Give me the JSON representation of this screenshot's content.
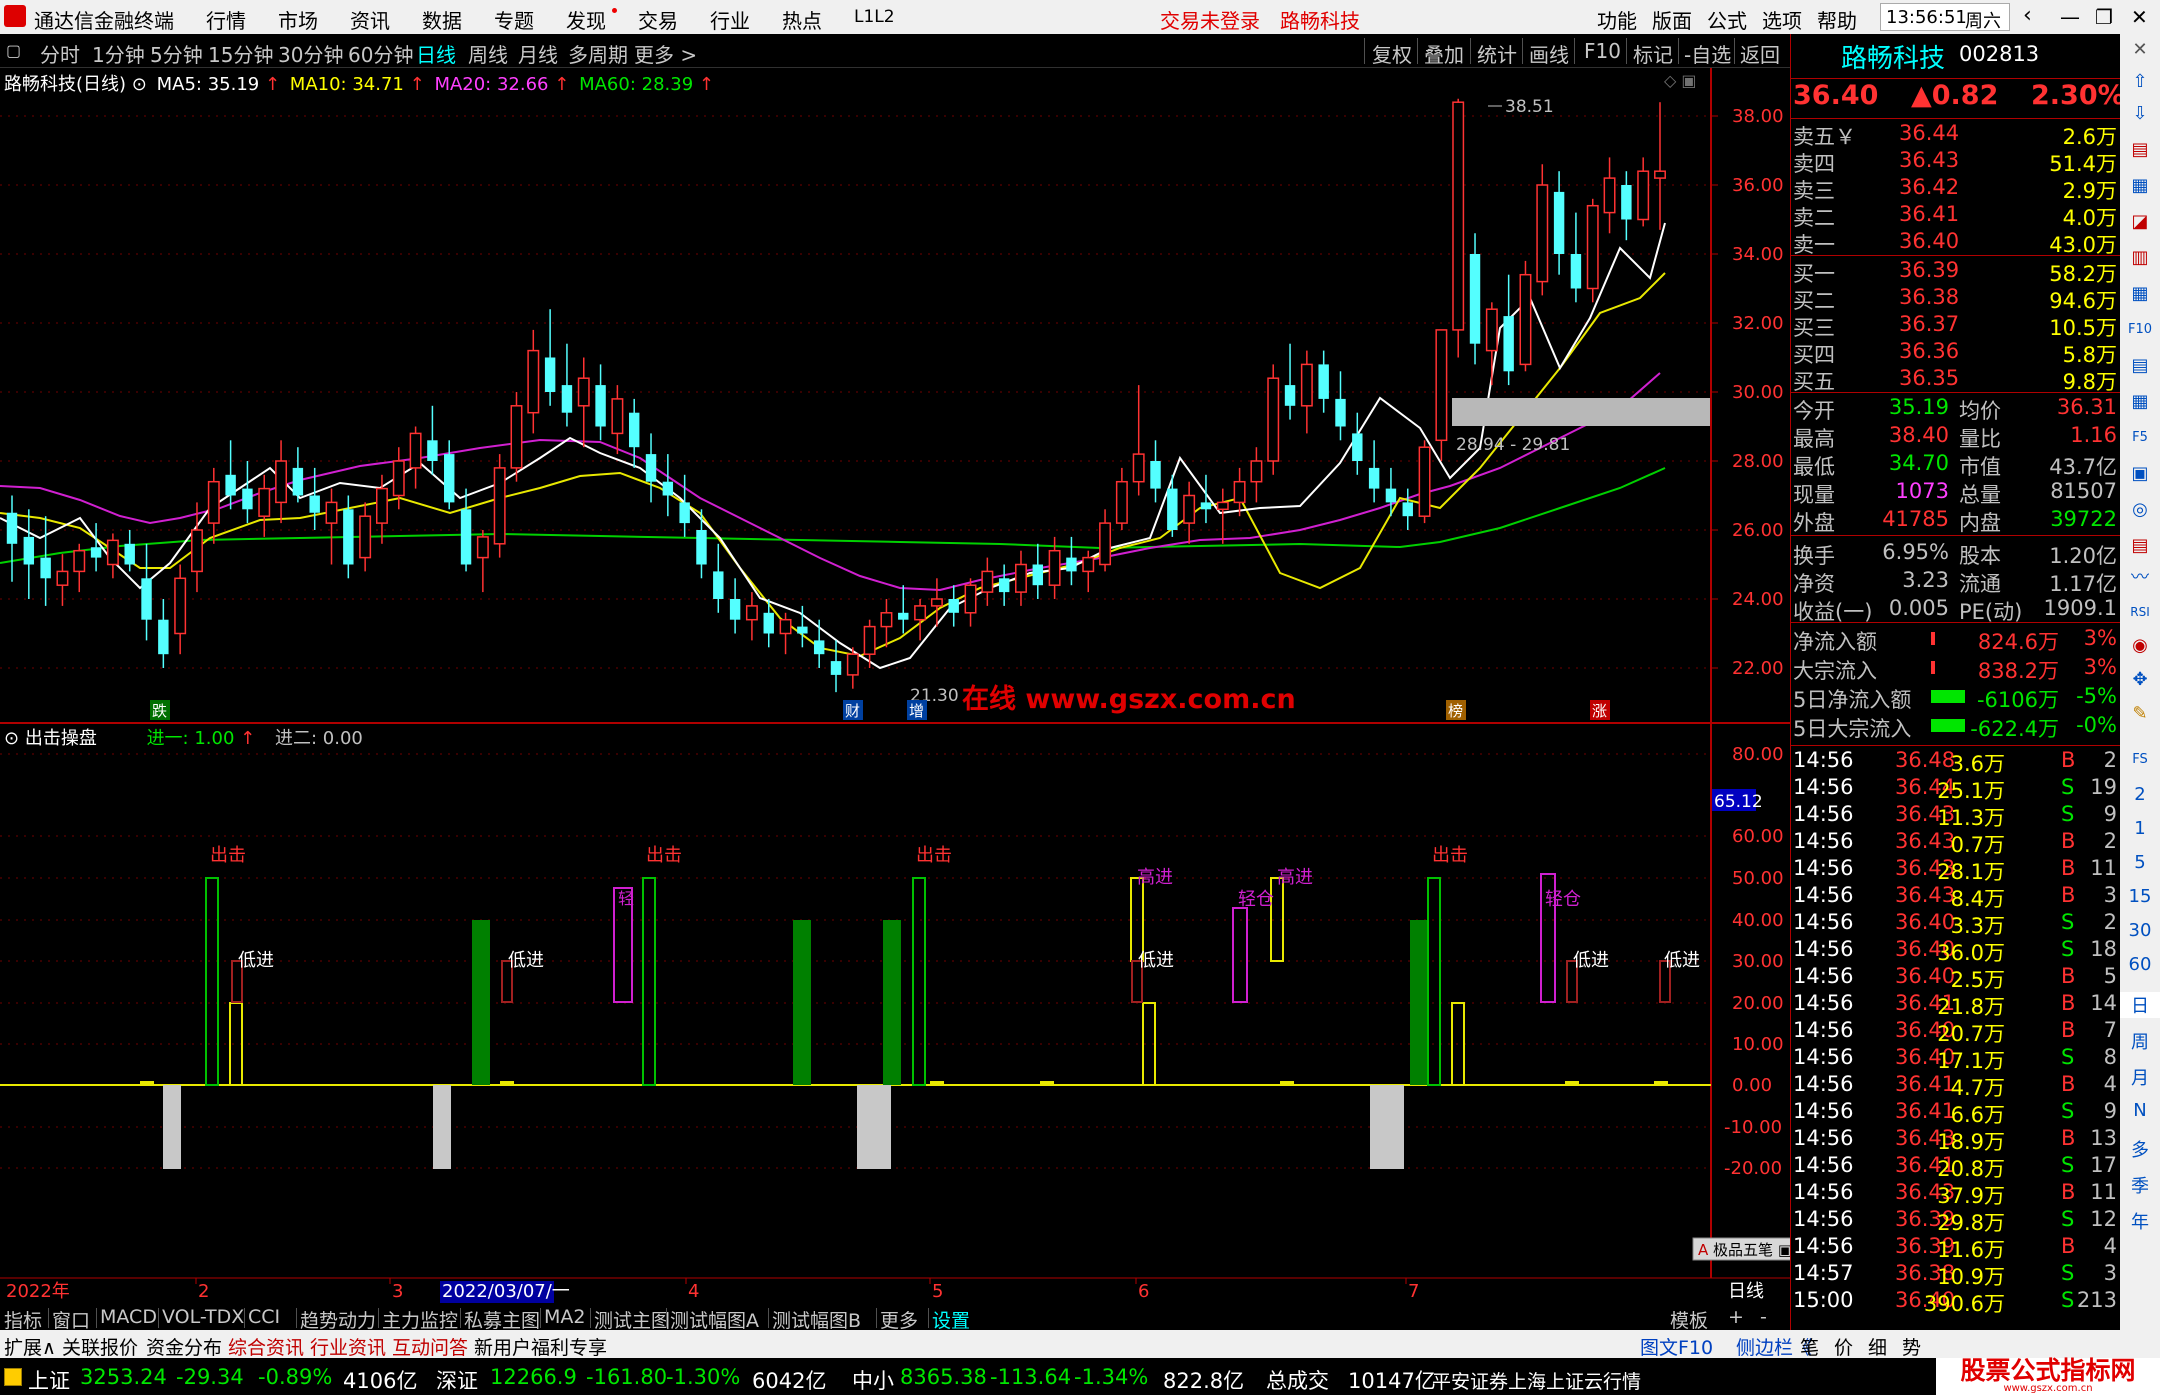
{
  "titlebar": {
    "app_name": "通达信金融终端",
    "menu": [
      "行情",
      "市场",
      "资讯",
      "数据",
      "专题",
      "发现",
      "交易",
      "行业",
      "热点",
      "L1L2"
    ],
    "status1": "交易未登录",
    "status2": "路畅科技",
    "right_menu": [
      "功能",
      "版面",
      "公式",
      "选项",
      "帮助"
    ],
    "time": "13:56:51",
    "weekday": "周六"
  },
  "periods": [
    "分时",
    "1分钟",
    "5分钟",
    "15分钟",
    "30分钟",
    "60分钟",
    "日线",
    "周线",
    "月线",
    "多周期",
    "更多 >"
  ],
  "active_period": "日线",
  "toolbar_right": [
    "复权",
    "叠加",
    "统计",
    "画线",
    "F10",
    "标记",
    "-自选",
    "返回"
  ],
  "chart_header": {
    "name": "路畅科技(日线)",
    "ma5": "MA5: 35.19",
    "ma10": "MA10: 34.71",
    "ma20": "MA20: 32.66",
    "ma60": "MA60: 28.39",
    "colors": {
      "ma5": "#ffffff",
      "ma10": "#ffff00",
      "ma20": "#ff40ff",
      "ma60": "#00e600"
    }
  },
  "price_axis": [
    "38.00",
    "36.00",
    "34.00",
    "32.00",
    "30.00",
    "28.00",
    "26.00",
    "24.00",
    "22.00"
  ],
  "annotations": {
    "high": "38.51",
    "low": "21.30",
    "range": "28.94 - 29.81",
    "watermark": "在线  www.gszx.com.cn",
    "markers": [
      "跌",
      "财",
      "增",
      "榜",
      "涨"
    ]
  },
  "indicator_header": {
    "name": "出击操盘",
    "v1": "进一: 1.00",
    "v2": "进二: 0.00"
  },
  "indicator_axis": [
    "80.00",
    "65.12",
    "60.00",
    "50.00",
    "40.00",
    "30.00",
    "20.00",
    "10.00",
    "0.00",
    "-10.00",
    "-20.00"
  ],
  "indicator_labels": {
    "chuji": "出击",
    "dijin": "低进",
    "gaojin": "高进",
    "qingcang": "轻仓"
  },
  "time_axis": [
    "2022年",
    "2",
    "3",
    "2022/03/07/一",
    "4",
    "5",
    "6",
    "7",
    "日线"
  ],
  "bottom_tabs": [
    "指标",
    "窗口",
    "MACD",
    "VOL-TDX",
    "CCI",
    "趋势动力",
    "主力监控",
    "私募主图",
    "MA2",
    "测试主图",
    "测试幅图A",
    "测试幅图B",
    "更多",
    "设置"
  ],
  "bottom_tabs_right": [
    "模板",
    "+",
    "-"
  ],
  "lower_tabs": [
    "扩展∧",
    "关联报价",
    "资金分布",
    "综合资讯",
    "行业资讯",
    "互动问答",
    "新用户福利专享"
  ],
  "lower_tabs_right": [
    "图文F10",
    "侧边栏《",
    "笔",
    "价",
    "细",
    "势"
  ],
  "widget": "极品五笔",
  "quote": {
    "name": "路畅科技",
    "code": "002813",
    "price": "36.40",
    "change": "▲0.82",
    "pct": "2.30%",
    "asks": [
      {
        "label": "卖五￥",
        "price": "36.44",
        "vol": "2.6万"
      },
      {
        "label": "卖四",
        "price": "36.43",
        "vol": "51.4万"
      },
      {
        "label": "卖三",
        "price": "36.42",
        "vol": "2.9万"
      },
      {
        "label": "卖二",
        "price": "36.41",
        "vol": "4.0万"
      },
      {
        "label": "卖一",
        "price": "36.40",
        "vol": "43.0万"
      }
    ],
    "bids": [
      {
        "label": "买一",
        "price": "36.39",
        "vol": "58.2万"
      },
      {
        "label": "买二",
        "price": "36.38",
        "vol": "94.6万"
      },
      {
        "label": "买三",
        "price": "36.37",
        "vol": "10.5万"
      },
      {
        "label": "买四",
        "price": "36.36",
        "vol": "5.8万"
      },
      {
        "label": "买五",
        "price": "36.35",
        "vol": "9.8万"
      }
    ],
    "stats": [
      {
        "l1": "今开",
        "v1": "35.19",
        "c1": "green",
        "l2": "均价",
        "v2": "36.31",
        "c2": "red"
      },
      {
        "l1": "最高",
        "v1": "38.40",
        "c1": "red",
        "l2": "量比",
        "v2": "1.16",
        "c2": "red"
      },
      {
        "l1": "最低",
        "v1": "34.70",
        "c1": "green",
        "l2": "市值",
        "v2": "43.7亿",
        "c2": "gray"
      },
      {
        "l1": "现量",
        "v1": "1073",
        "c1": "mag",
        "l2": "总量",
        "v2": "81507",
        "c2": "gray"
      },
      {
        "l1": "外盘",
        "v1": "41785",
        "c1": "red",
        "l2": "内盘",
        "v2": "39722",
        "c2": "green"
      },
      {
        "l1": "换手",
        "v1": "6.95%",
        "c1": "gray",
        "l2": "股本",
        "v2": "1.20亿",
        "c2": "gray"
      },
      {
        "l1": "净资",
        "v1": "3.23",
        "c1": "gray",
        "l2": "流通",
        "v2": "1.17亿",
        "c2": "gray"
      },
      {
        "l1": "收益(一)",
        "v1": "0.005",
        "c1": "gray",
        "l2": "PE(动)",
        "v2": "1909.1",
        "c2": "gray"
      }
    ],
    "flows": [
      {
        "label": "净流入额",
        "value": "824.6万",
        "pct": "3%",
        "c": "red"
      },
      {
        "label": "大宗流入",
        "value": "838.2万",
        "pct": "3%",
        "c": "red"
      },
      {
        "label": "5日净流入额",
        "value": "-6106万",
        "pct": "-5%",
        "c": "green"
      },
      {
        "label": "5日大宗流入",
        "value": "-622.4万",
        "pct": "-0%",
        "c": "green"
      }
    ],
    "ticks": [
      [
        "14:56",
        "36.48",
        "3.6万",
        "B",
        "2"
      ],
      [
        "14:56",
        "36.44",
        "25.1万",
        "S",
        "19"
      ],
      [
        "14:56",
        "36.43",
        "11.3万",
        "S",
        "9"
      ],
      [
        "14:56",
        "36.43",
        "0.7万",
        "B",
        "2"
      ],
      [
        "14:56",
        "36.43",
        "28.1万",
        "B",
        "11"
      ],
      [
        "14:56",
        "36.43",
        "8.4万",
        "B",
        "3"
      ],
      [
        "14:56",
        "36.40",
        "3.3万",
        "S",
        "2"
      ],
      [
        "14:56",
        "36.40",
        "36.0万",
        "S",
        "18"
      ],
      [
        "14:56",
        "36.40",
        "2.5万",
        "B",
        "5"
      ],
      [
        "14:56",
        "36.41",
        "21.8万",
        "B",
        "14"
      ],
      [
        "14:56",
        "36.40",
        "20.7万",
        "B",
        "7"
      ],
      [
        "14:56",
        "36.40",
        "17.1万",
        "S",
        "8"
      ],
      [
        "14:56",
        "36.41",
        "4.7万",
        "B",
        "4"
      ],
      [
        "14:56",
        "36.41",
        "6.6万",
        "S",
        "9"
      ],
      [
        "14:56",
        "36.43",
        "18.9万",
        "B",
        "13"
      ],
      [
        "14:56",
        "36.41",
        "20.8万",
        "S",
        "17"
      ],
      [
        "14:56",
        "36.43",
        "37.9万",
        "B",
        "11"
      ],
      [
        "14:56",
        "36.39",
        "29.8万",
        "S",
        "12"
      ],
      [
        "14:56",
        "36.39",
        "11.6万",
        "B",
        "4"
      ],
      [
        "14:57",
        "36.38",
        "10.9万",
        "S",
        "3"
      ],
      [
        "15:00",
        "36.40",
        "390.6万",
        "S",
        "213"
      ]
    ]
  },
  "sidebar_text": [
    "日",
    "周",
    "月",
    "N",
    "多",
    "季",
    "年"
  ],
  "statusbar": [
    {
      "name": "上证",
      "value": "3253.24",
      "chg": "-29.34",
      "pct": "-0.89%",
      "amt": "4106亿"
    },
    {
      "name": "深证",
      "value": "12266.9",
      "chg": "-161.80",
      "pct": "-1.30%",
      "amt": "6042亿"
    },
    {
      "name": "中小",
      "value": "8365.38",
      "chg": "-113.64",
      "pct": "-1.34%",
      "amt": "822.8亿"
    }
  ],
  "status_total_label": "总成交",
  "status_total": "10147亿",
  "status_broker": "平安证券上海上证云行情",
  "logo_text": "股票公式指标网",
  "logo_url": "www.gszx.com.cn"
}
